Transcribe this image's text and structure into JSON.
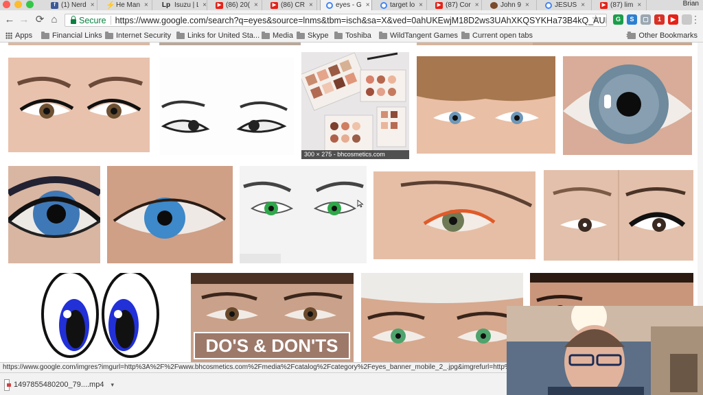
{
  "browser": {
    "tabs": [
      {
        "icon": "facebook-icon",
        "label": "(1) Nerd",
        "active": false
      },
      {
        "icon": "he-icon",
        "label": "He Man",
        "active": false
      },
      {
        "icon": "lp-icon",
        "label": "Isuzu | L",
        "active": false
      },
      {
        "icon": "youtube-icon",
        "label": "(86) 20(",
        "active": false
      },
      {
        "icon": "youtube-icon",
        "label": "(86) CR",
        "active": false
      },
      {
        "icon": "google-icon",
        "label": "eyes - G",
        "active": true
      },
      {
        "icon": "google-icon",
        "label": "target lo",
        "active": false
      },
      {
        "icon": "youtube-icon",
        "label": "(87) Cor",
        "active": false
      },
      {
        "icon": "john-icon",
        "label": "John 9",
        "active": false
      },
      {
        "icon": "google-icon",
        "label": "JESUS",
        "active": false
      },
      {
        "icon": "youtube-icon",
        "label": "(87) lim",
        "active": false
      }
    ],
    "tab_close_glyph": "×",
    "lp_glyph": "Lp",
    "user_name": "Brian",
    "secure_label": "Secure",
    "url": "https://www.google.com/search?q=eyes&source=lnms&tbm=isch&sa=X&ved=0ahUKEwjM18D2ws3UAhXKQSYKHa73B4kQ_AUICig...",
    "ext_badge": "1",
    "bookmarks": [
      {
        "label": "Apps",
        "icon": "apps-icon"
      },
      {
        "label": "Financial Links",
        "icon": "folder-icon"
      },
      {
        "label": "Internet Security",
        "icon": "folder-icon"
      },
      {
        "label": "Links for United Sta...",
        "icon": "folder-icon"
      },
      {
        "label": "Media",
        "icon": "folder-icon"
      },
      {
        "label": "Skype",
        "icon": "folder-icon"
      },
      {
        "label": "Toshiba",
        "icon": "folder-icon"
      },
      {
        "label": "WildTangent Games",
        "icon": "folder-icon"
      },
      {
        "label": "Current open tabs",
        "icon": "folder-icon"
      }
    ],
    "bookmarks_overflow": "»",
    "other_bookmarks": "Other Bookmarks"
  },
  "results": {
    "hover_caption": "300 × 275 - bhcosmetics.com",
    "overlay_text": "DO'S & DON'TS",
    "images": [
      {
        "name": "eyes-lashes-thumb"
      },
      {
        "name": "eyes-sketch-thumb"
      },
      {
        "name": "eyeshadow-palette-thumb"
      },
      {
        "name": "child-blue-eyes-thumb"
      },
      {
        "name": "grey-iris-thumb"
      },
      {
        "name": "blue-eye-makeup-thumb"
      },
      {
        "name": "blue-eye-closeup-thumb"
      },
      {
        "name": "green-eyes-bw-thumb"
      },
      {
        "name": "orange-lash-thumb"
      },
      {
        "name": "eye-makeup-before-after-thumb"
      },
      {
        "name": "cartoon-eyes-thumb"
      },
      {
        "name": "dos-donts-eyes-thumb"
      },
      {
        "name": "green-eyes-beanie-thumb"
      },
      {
        "name": "dark-eyes-thumb"
      }
    ]
  },
  "status_url": "https://www.google.com/imgres?imgurl=http%3A%2F%2Fwww.bhcosmetics.com%2Fmedia%2Fcatalog%2Fcategory%2Feyes_banner_mobile_2_.jpg&imgrefurl=http%3A%2F%2",
  "downloads": {
    "file_name": "1497855480200_79....mp4",
    "caret": "▾"
  },
  "colors": {
    "chrome_bg": "#f2f2f2",
    "secure_green": "#0b8043",
    "youtube_red": "#e62117",
    "facebook_blue": "#3b5998"
  }
}
